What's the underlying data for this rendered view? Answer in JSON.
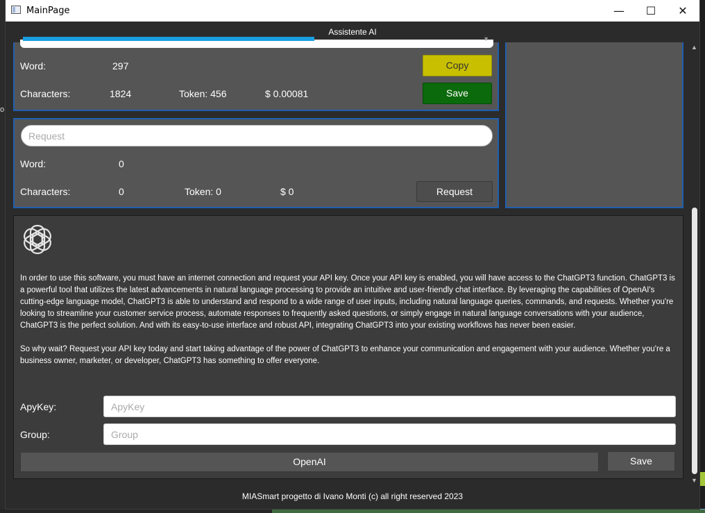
{
  "window": {
    "title": "MainPage",
    "minimize": "—",
    "maximize": "☐",
    "close": "✕"
  },
  "header": {
    "title": "Assistente AI"
  },
  "response": {
    "word_label": "Word:",
    "word_value": "297",
    "chars_label": "Characters:",
    "chars_value": "1824",
    "token_text": "Token: 456",
    "cost_text": "$ 0.00081",
    "copy_label": "Copy",
    "save_label": "Save"
  },
  "request": {
    "placeholder": "Request",
    "word_label": "Word:",
    "word_value": "0",
    "chars_label": "Characters:",
    "chars_value": "0",
    "token_text": "Token: 0",
    "cost_text": "$ 0",
    "button_label": "Request"
  },
  "settings": {
    "logo_icon": "openai-logo-icon",
    "paragraph1": "In order to use this software, you must have an internet connection and request your API key. Once your API key is enabled, you will have access to the ChatGPT3 function. ChatGPT3 is a powerful tool that utilizes the latest advancements in natural language processing to provide an intuitive and user-friendly chat interface. By leveraging the capabilities of OpenAI's cutting-edge language model, ChatGPT3 is able to understand and respond to a wide range of user inputs, including natural language queries, commands, and requests. Whether you're looking to streamline your customer service process, automate responses to frequently asked questions, or simply engage in natural language conversations with your audience, ChatGPT3 is the perfect solution. And with its easy-to-use interface and robust API, integrating ChatGPT3 into your existing workflows has never been easier.",
    "paragraph2": "So why wait? Request your API key today and start taking advantage of the power of ChatGPT3 to enhance your communication and engagement with your audience. Whether you're a business owner, marketer, or developer, ChatGPT3 has something to offer everyone.",
    "apikey_label": "ApyKey:",
    "apikey_placeholder": "ApyKey",
    "group_label": "Group:",
    "group_placeholder": "Group",
    "openai_button": "OpenAI",
    "save_button": "Save"
  },
  "footer": {
    "text": "MIASmart progetto di Ivano Monti (c) all right reserved 2023"
  },
  "colors": {
    "accent_border": "#1f5fb0",
    "copy_button": "#c8bf00",
    "save_button": "#0b6a0b",
    "panel_bg": "#555555",
    "window_bg": "#2b2b2b"
  }
}
